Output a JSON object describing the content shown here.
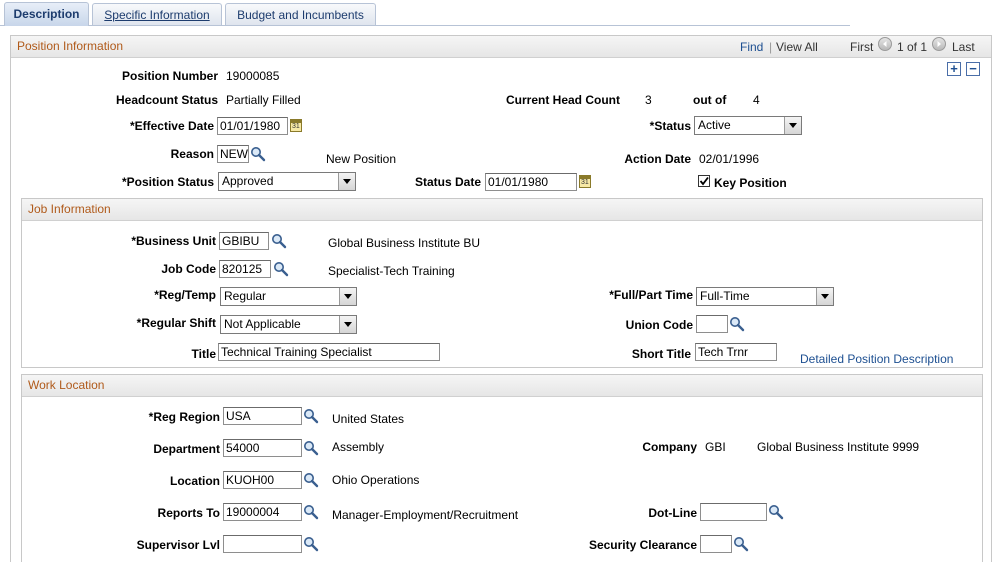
{
  "tabs": [
    {
      "label": "Description",
      "active": true
    },
    {
      "label": "Specific Information",
      "active": false
    },
    {
      "label": "Budget and Incumbents",
      "active": false
    }
  ],
  "position_info": {
    "title": "Position Information",
    "nav": {
      "find": "Find",
      "view_all": "View All",
      "first": "First",
      "page_info": "1 of 1",
      "last": "Last"
    },
    "add_btn": "+",
    "remove_btn": "−",
    "position_number_label": "Position Number",
    "position_number": "19000085",
    "headcount_status_label": "Headcount Status",
    "headcount_status": "Partially Filled",
    "current_head_count_label": "Current Head Count",
    "current_head_count": "3",
    "out_of_label": "out of",
    "max_head_count": "4",
    "effective_date_label": "*Effective Date",
    "effective_date": "01/01/1980",
    "status_label": "*Status",
    "status": "Active",
    "reason_label": "Reason",
    "reason": "NEW",
    "reason_desc": "New Position",
    "action_date_label": "Action Date",
    "action_date": "02/01/1996",
    "position_status_label": "*Position Status",
    "position_status": "Approved",
    "status_date_label": "Status Date",
    "status_date": "01/01/1980",
    "key_position_label": "Key Position",
    "key_position_checked": true
  },
  "job_info": {
    "title": "Job Information",
    "business_unit_label": "*Business Unit",
    "business_unit": "GBIBU",
    "business_unit_desc": "Global Business Institute BU",
    "job_code_label": "Job Code",
    "job_code": "820125",
    "job_code_desc": "Specialist-Tech Training",
    "reg_temp_label": "*Reg/Temp",
    "reg_temp": "Regular",
    "full_part_label": "*Full/Part Time",
    "full_part": "Full-Time",
    "regular_shift_label": "*Regular Shift",
    "regular_shift": "Not Applicable",
    "union_code_label": "Union Code",
    "union_code": "",
    "title_label": "Title",
    "title_value": "Technical Training Specialist",
    "short_title_label": "Short Title",
    "short_title": "Tech Trnr",
    "detailed_link": "Detailed Position Description"
  },
  "work_location": {
    "title": "Work Location",
    "reg_region_label": "*Reg Region",
    "reg_region": "USA",
    "reg_region_desc": "United States",
    "department_label": "Department",
    "department": "54000",
    "department_desc": "Assembly",
    "company_label": "Company",
    "company": "GBI",
    "company_desc": "Global Business Institute 9999",
    "location_label": "Location",
    "location": "KUOH00",
    "location_desc": "Ohio Operations",
    "reports_to_label": "Reports To",
    "reports_to": "19000004",
    "reports_to_desc": "Manager-Employment/Recruitment",
    "dot_line_label": "Dot-Line",
    "dot_line": "",
    "supervisor_lvl_label": "Supervisor Lvl",
    "supervisor_lvl": "",
    "security_clearance_label": "Security Clearance",
    "security_clearance": ""
  },
  "icons": {
    "lookup": "magnifier-icon",
    "calendar": "calendar-icon",
    "dropdown": "chevron-down-icon"
  },
  "colors": {
    "section_title": "#b05a1a",
    "link": "#1d4f91"
  }
}
